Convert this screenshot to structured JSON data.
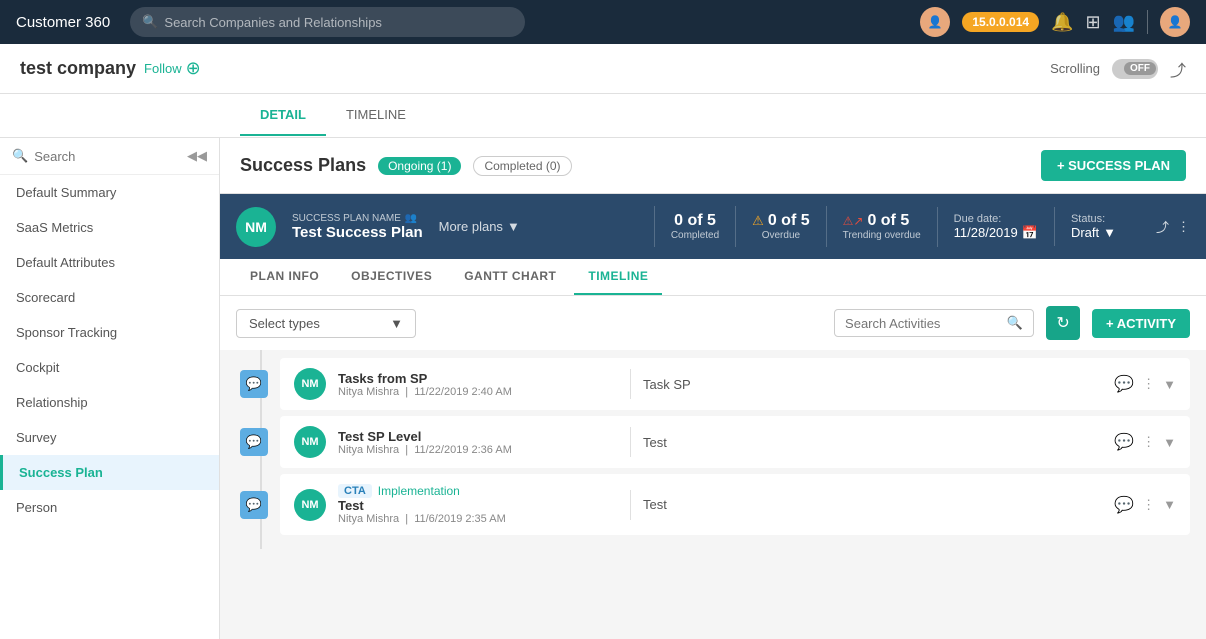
{
  "app": {
    "title": "Customer 360",
    "version": "15.0.0.014",
    "search_placeholder": "Search Companies and Relationships"
  },
  "company_bar": {
    "company_name": "test company",
    "follow_label": "Follow",
    "scrolling_label": "Scrolling",
    "toggle_state": "OFF"
  },
  "tabs": {
    "detail": "DETAIL",
    "timeline": "TIMELINE"
  },
  "sidebar": {
    "search_placeholder": "Search",
    "items": [
      {
        "label": "Default Summary",
        "active": false
      },
      {
        "label": "SaaS Metrics",
        "active": false
      },
      {
        "label": "Default Attributes",
        "active": false
      },
      {
        "label": "Scorecard",
        "active": false
      },
      {
        "label": "Sponsor Tracking",
        "active": false
      },
      {
        "label": "Cockpit",
        "active": false
      },
      {
        "label": "Relationship",
        "active": false
      },
      {
        "label": "Survey",
        "active": false
      },
      {
        "label": "Success Plan",
        "active": true
      },
      {
        "label": "Person",
        "active": false
      }
    ]
  },
  "success_plans": {
    "title": "Success Plans",
    "ongoing_label": "Ongoing (1)",
    "completed_label": "Completed (0)",
    "add_btn": "+ SUCCESS PLAN"
  },
  "plan_card": {
    "avatar_initials": "NM",
    "label": "SUCCESS PLAN NAME",
    "name": "Test Success Plan",
    "more_plans": "More plans",
    "completed": {
      "count": "0 of 5",
      "label": "Completed"
    },
    "overdue": {
      "count": "0 of 5",
      "label": "Overdue"
    },
    "trending": {
      "count": "0 of 5",
      "label": "Trending overdue"
    },
    "due_date_label": "Due date:",
    "due_date": "11/28/2019",
    "status_label": "Status:",
    "status_value": "Draft"
  },
  "plan_subtabs": [
    {
      "label": "PLAN INFO",
      "active": false
    },
    {
      "label": "OBJECTIVES",
      "active": false
    },
    {
      "label": "GANTT CHART",
      "active": false
    },
    {
      "label": "TIMELINE",
      "active": true
    }
  ],
  "timeline_toolbar": {
    "select_types_placeholder": "Select types",
    "search_placeholder": "Search Activities",
    "add_activity_btn": "+ ACTIVITY"
  },
  "activities": [
    {
      "type_icon": "💬",
      "avatar": "NM",
      "title": "Tasks from SP",
      "meta": "Nitya Mishra  |  11/22/2019 2:40 AM",
      "description": "Task SP",
      "cta_tag": null,
      "impl_tag": null
    },
    {
      "type_icon": "💬",
      "avatar": "NM",
      "title": "Test SP Level",
      "meta": "Nitya Mishra  |  11/22/2019 2:36 AM",
      "description": "Test",
      "cta_tag": null,
      "impl_tag": null
    },
    {
      "type_icon": "💬",
      "avatar": "NM",
      "title": "Test",
      "meta": "Nitya Mishra  |  11/6/2019 2:35 AM",
      "description": "Test",
      "cta_tag": "CTA",
      "impl_tag": "Implementation"
    }
  ]
}
